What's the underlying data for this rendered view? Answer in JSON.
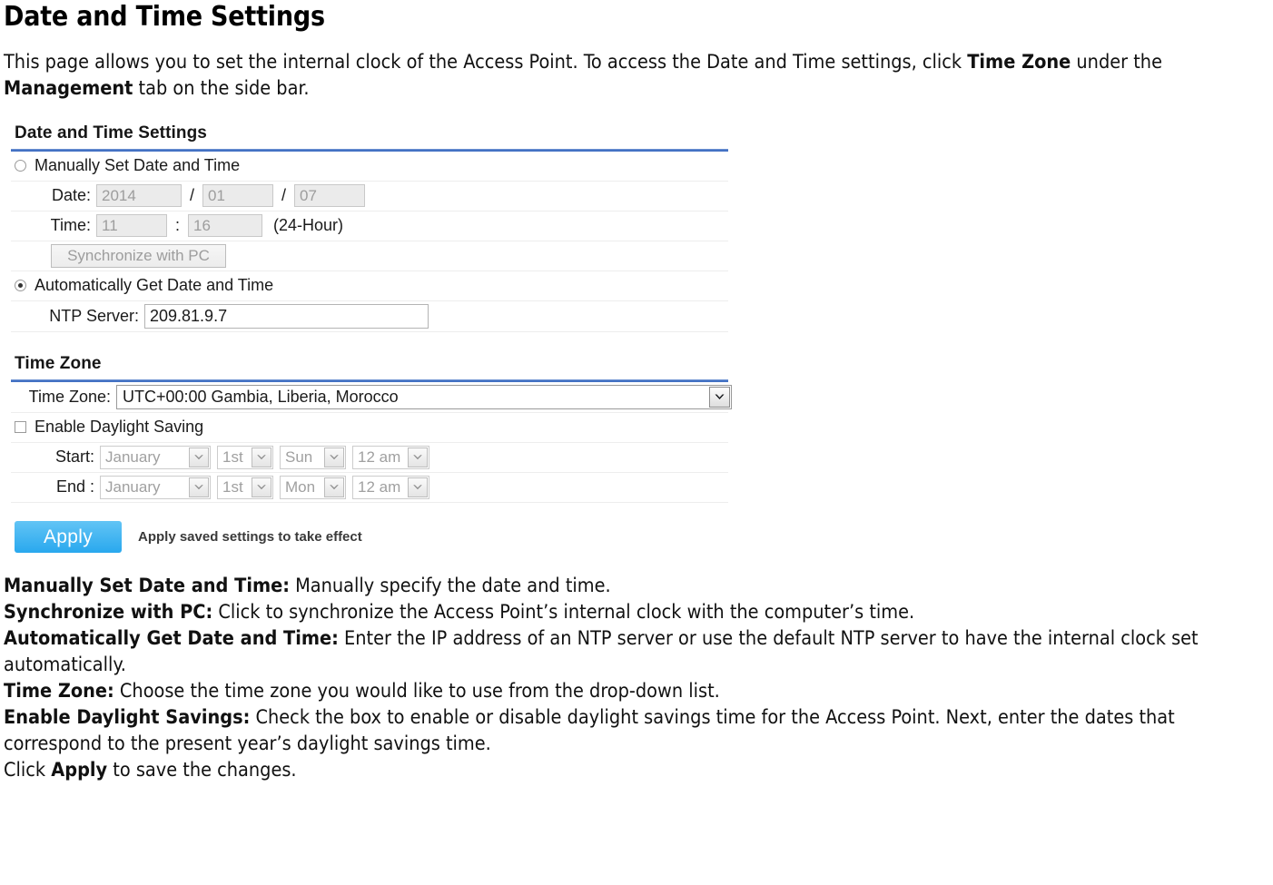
{
  "doc": {
    "title": "Date and Time Settings",
    "intro": {
      "part1": "This page allows you to set the internal clock of the Access Point. To access the Date and Time settings, click ",
      "bold1": "Time Zone",
      "part2": " under the ",
      "bold2": "Management",
      "part3": " tab on the side bar."
    }
  },
  "panel": {
    "section_datetime_title": "Date and Time Settings",
    "manual_option_label": "Manually Set Date and Time",
    "manual_selected": false,
    "date_label": "Date:",
    "date_year": "2014",
    "date_month": "01",
    "date_day": "07",
    "date_sep": "/",
    "time_label": "Time:",
    "time_hour": "11",
    "time_minute": "16",
    "time_sep": ":",
    "time_format_note": "(24-Hour)",
    "sync_button_label": "Synchronize with PC",
    "auto_option_label": "Automatically Get Date and Time",
    "auto_selected": true,
    "ntp_label": "NTP Server:",
    "ntp_value": "209.81.9.7",
    "section_timezone_title": "Time Zone",
    "timezone_label": "Time Zone:",
    "timezone_value": "UTC+00:00 Gambia, Liberia, Morocco",
    "dst_checkbox_label": "Enable Daylight Saving",
    "dst_checked": false,
    "start_label": "Start:",
    "start_month": "January",
    "start_ordinal": "1st",
    "start_weekday": "Sun",
    "start_hour": "12 am",
    "end_label": "End :",
    "end_month": "January",
    "end_ordinal": "1st",
    "end_weekday": "Mon",
    "end_hour": "12 am",
    "apply_button_label": "Apply",
    "apply_note": "Apply saved settings to take effect",
    "colors": {
      "accent_rule": "#4472c4",
      "apply_top": "#62c4f5",
      "apply_bottom": "#29a8ee",
      "row_divider": "#ededed"
    }
  },
  "descriptions": [
    {
      "term": "Manually Set Date and Time:",
      "text": " Manually specify the date and time."
    },
    {
      "term": "Synchronize with PC:",
      "text": " Click to synchronize the Access Point’s internal clock with the computer’s time."
    },
    {
      "term": "Automatically Get Date and Time:",
      "text": " Enter the IP address of an NTP server or use the default NTP server to have the internal clock set automatically."
    },
    {
      "term": "Time Zone:",
      "text": " Choose the time zone you would like to use from the drop-down list."
    },
    {
      "term": "Enable Daylight Savings:",
      "text": " Check the box to enable or disable daylight savings time for the Access Point. Next, enter the dates that correspond to the present year’s daylight savings time."
    }
  ],
  "closing": {
    "pre": "Click ",
    "bold": "Apply",
    "post": " to save the changes."
  }
}
